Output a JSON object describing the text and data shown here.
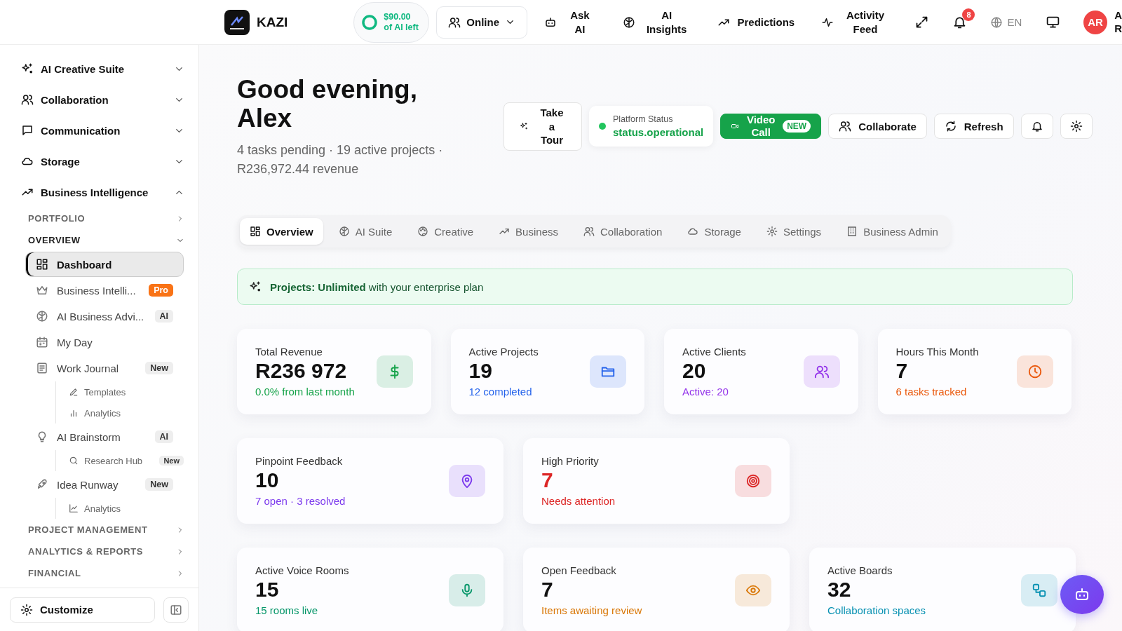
{
  "header": {
    "logo_text": "KAZI",
    "credit": "$90.00 of AI left",
    "status": {
      "label": "Online"
    },
    "nav": [
      {
        "label": "Ask AI"
      },
      {
        "label": "AI Insights"
      },
      {
        "label": "Predictions"
      },
      {
        "label": "Activity Feed"
      }
    ],
    "notifications": "8",
    "language": "EN",
    "avatar": "AR",
    "user_name": [
      "A",
      "R"
    ]
  },
  "sidebar": {
    "groups": [
      {
        "label": "AI Creative Suite",
        "expanded": false
      },
      {
        "label": "Collaboration",
        "expanded": false
      },
      {
        "label": "Communication",
        "expanded": false
      },
      {
        "label": "Storage",
        "expanded": false
      },
      {
        "label": "Business Intelligence",
        "expanded": true,
        "sections": [
          {
            "label": "PORTFOLIO",
            "expanded": false
          },
          {
            "label": "OVERVIEW",
            "expanded": true,
            "items": [
              {
                "label": "Dashboard",
                "selected": true
              },
              {
                "label": "Business Intelli...",
                "selected": false,
                "badge": {
                  "text": "Pro",
                  "kind": "accent"
                }
              },
              {
                "label": "AI Business Advi...",
                "selected": false,
                "badge": {
                  "text": "AI",
                  "kind": "muted"
                }
              },
              {
                "label": "My Day",
                "selected": false
              },
              {
                "label": "Work Journal",
                "selected": false,
                "badge": {
                  "text": "New",
                  "kind": "muted"
                },
                "children": [
                  {
                    "label": "Templates",
                    "selected": false
                  },
                  {
                    "label": "Analytics",
                    "selected": false
                  }
                ]
              },
              {
                "label": "AI Brainstorm",
                "selected": false,
                "badge": {
                  "text": "AI",
                  "kind": "muted"
                },
                "children": [
                  {
                    "label": "Research Hub",
                    "selected": false,
                    "badge": {
                      "text": "New",
                      "kind": "muted"
                    }
                  }
                ]
              },
              {
                "label": "Idea Runway",
                "selected": false,
                "badge": {
                  "text": "New",
                  "kind": "muted"
                },
                "children": [
                  {
                    "label": "Analytics",
                    "selected": false
                  }
                ]
              }
            ]
          },
          {
            "label": "PROJECT MANAGEMENT",
            "expanded": false
          },
          {
            "label": "ANALYTICS & REPORTS",
            "expanded": false
          },
          {
            "label": "FINANCIAL",
            "expanded": false
          }
        ]
      }
    ],
    "customize": "Customize"
  },
  "hero": {
    "title": "Good evening, Alex",
    "subtitle": "4 tasks pending · 19 active projects · R236,972.44 revenue",
    "tour": "Take a Tour",
    "platform_status": {
      "label": "Platform Status",
      "value": "status.operational"
    },
    "video_call": {
      "label": "Video Call",
      "badge": "NEW"
    },
    "collaborate": "Collaborate",
    "refresh": "Refresh"
  },
  "tabs": [
    {
      "label": "Overview",
      "selected": true
    },
    {
      "label": "AI Suite",
      "selected": false
    },
    {
      "label": "Creative",
      "selected": false
    },
    {
      "label": "Business",
      "selected": false
    },
    {
      "label": "Collaboration",
      "selected": false
    },
    {
      "label": "Storage",
      "selected": false
    },
    {
      "label": "Settings",
      "selected": false
    },
    {
      "label": "Business Admin",
      "selected": false
    }
  ],
  "banner": "**Projects: Unlimited** with your enterprise plan",
  "metric_rows": [
    [
      {
        "title": "Total Revenue",
        "value": "R236 972",
        "note": "0.0% from last month",
        "color": "#16a34a"
      },
      {
        "title": "Active Projects",
        "value": "19",
        "note": "12 completed",
        "color": "#2563eb"
      },
      {
        "title": "Active Clients",
        "value": "20",
        "note": "Active: 20",
        "color": "#9333ea"
      },
      {
        "title": "Hours This Month",
        "value": "7",
        "note": "6 tasks tracked",
        "color": "#ea580c"
      }
    ],
    [
      {
        "title": "Pinpoint Feedback",
        "value": "10",
        "note": "7 open · 3 resolved",
        "color": "#7c3aed"
      },
      {
        "title": "High Priority",
        "value": "7",
        "note": "Needs attention",
        "color": "#dc2626"
      }
    ],
    [
      {
        "title": "Active Voice Rooms",
        "value": "15",
        "note": "15 rooms live",
        "color": "#059669"
      },
      {
        "title": "Open Feedback",
        "value": "7",
        "note": "Items awaiting review",
        "color": "#d97706"
      },
      {
        "title": "Active Boards",
        "value": "32",
        "note": "Collaboration spaces",
        "color": "#0891b2"
      }
    ]
  ]
}
